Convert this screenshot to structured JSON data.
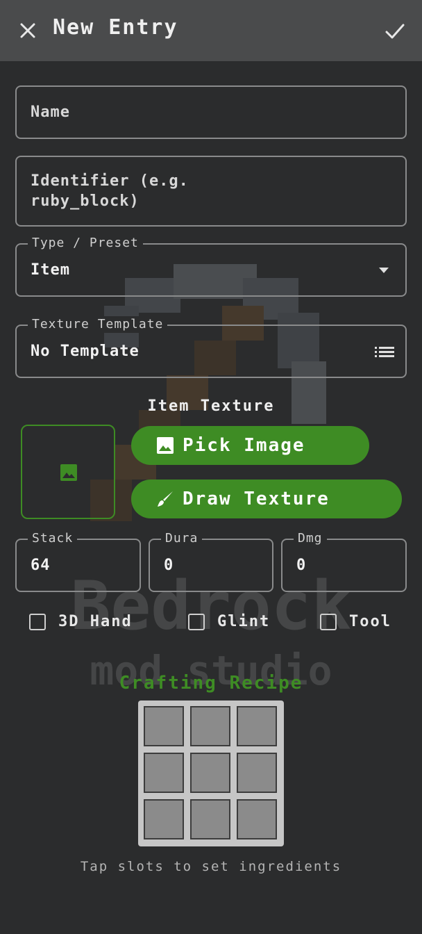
{
  "colors": {
    "accent": "#3e8c24",
    "background": "#2b2c2d",
    "toolbar": "#4a4b4c"
  },
  "toolbar": {
    "close_icon": "close-icon",
    "title": "New Entry",
    "confirm_icon": "check-icon"
  },
  "form": {
    "name": {
      "placeholder": "Name",
      "value": ""
    },
    "identifier": {
      "placeholder_line1": "Identifier (e.g.",
      "placeholder_line2": "ruby_block)",
      "value": ""
    },
    "type": {
      "label": "Type / Preset",
      "value": "Item",
      "icon": "dropdown-arrow-icon"
    },
    "texture_template": {
      "label": "Texture Template",
      "value": "No Template",
      "icon": "list-icon"
    }
  },
  "texture": {
    "title": "Item Texture",
    "preview_icon": "image-icon",
    "pick_label": "Pick Image",
    "draw_label": "Draw Texture"
  },
  "stats": {
    "stack": {
      "label": "Stack",
      "value": "64"
    },
    "dura": {
      "label": "Dura",
      "value": "0"
    },
    "dmg": {
      "label": "Dmg",
      "value": "0"
    }
  },
  "flags": [
    {
      "label": "3D Hand",
      "checked": false
    },
    {
      "label": "Glint",
      "checked": false
    },
    {
      "label": "Tool",
      "checked": false
    }
  ],
  "recipe": {
    "title": "Crafting Recipe",
    "slots": 9,
    "hint": "Tap slots to set ingredients"
  },
  "watermark": {
    "line1": "Bedrock",
    "line2": "mod studio"
  }
}
